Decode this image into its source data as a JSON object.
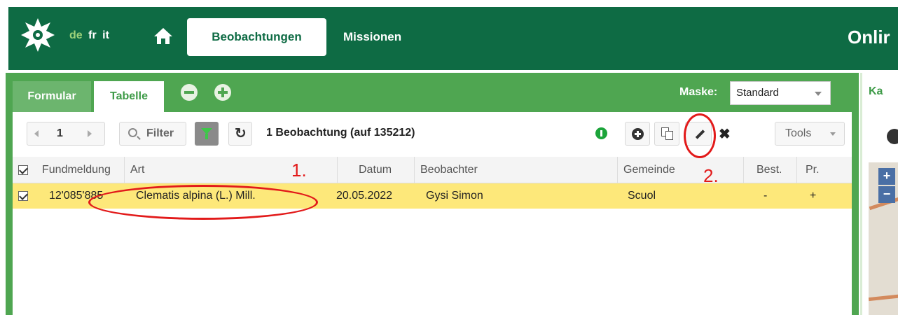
{
  "header": {
    "languages": [
      "de",
      "fr",
      "it"
    ],
    "active_language": "de",
    "nav": [
      "Beobachtungen",
      "Missionen"
    ],
    "title": "Onlir",
    "colors": {
      "header_bg": "#0e6b44",
      "active_lang": "#9ed27a"
    }
  },
  "panel": {
    "tabs": [
      "Formular",
      "Tabelle"
    ],
    "active_tab": "Tabelle",
    "mask_label": "Maske:",
    "mask_value": "Standard"
  },
  "toolbar": {
    "page": "1",
    "filter_label": "Filter",
    "count_text": "1 Beobachtung (auf 135212)",
    "tools_label": "Tools",
    "icons": [
      "search-icon",
      "funnel-icon",
      "refresh-icon",
      "info-icon",
      "plus-icon",
      "copy-icon",
      "pencil-icon",
      "close-icon"
    ]
  },
  "table": {
    "columns": [
      "Fundmeldung",
      "Art",
      "Datum",
      "Beobachter",
      "Gemeinde",
      "Best.",
      "Pr."
    ],
    "rows": [
      {
        "selected": true,
        "fundmeldung": "12'085'885",
        "art": "Clematis alpina (L.) Mill.",
        "datum": "20.05.2022",
        "beobachter": "Gysi Simon",
        "gemeinde": "Scuol",
        "best": "-",
        "pr": "+"
      }
    ],
    "row_highlight": "#fde87a"
  },
  "annotations": {
    "step1": "1.",
    "step2": "2.",
    "color": "#e21a1a"
  },
  "right_panel": {
    "tab_label": "Ka",
    "zoom_in": "+",
    "zoom_out": "−"
  }
}
